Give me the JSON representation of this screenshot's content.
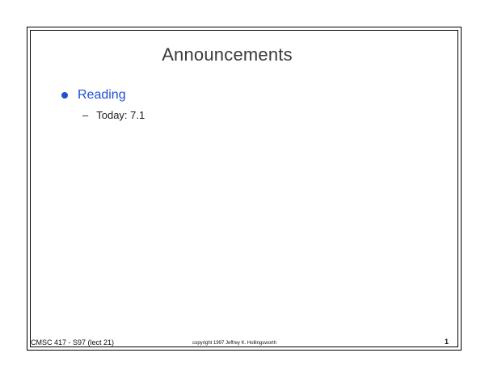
{
  "slide": {
    "title": "Announcements",
    "bullets": [
      {
        "label": "Reading",
        "color": "#1f4fd6",
        "sub_items": [
          {
            "marker": "–",
            "text": "Today: 7.1"
          }
        ]
      }
    ]
  },
  "footer": {
    "course": "CMSC 417 - S97  (lect 21)",
    "copyright": "copyright 1997  Jeffrey K. Hollingsworth",
    "page_number": "1"
  },
  "colors": {
    "bullet": "#1f4fd6",
    "frame": "#000000",
    "title_text": "#3a3a3a"
  }
}
